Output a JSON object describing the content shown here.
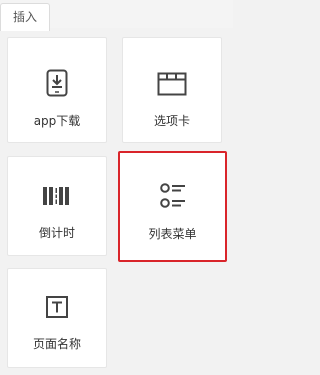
{
  "tab": {
    "label": "插入"
  },
  "items": [
    {
      "label": "app下载",
      "icon": "phone-download-icon"
    },
    {
      "label": "选项卡",
      "icon": "tab-window-icon"
    },
    {
      "label": "倒计时",
      "icon": "countdown-bars-icon"
    },
    {
      "label": "列表菜单",
      "icon": "list-menu-icon",
      "selected": true
    },
    {
      "label": "页面名称",
      "icon": "text-t-icon"
    }
  ],
  "colors": {
    "selection_border": "#d9242a",
    "icon": "#444444",
    "text": "#333333"
  }
}
